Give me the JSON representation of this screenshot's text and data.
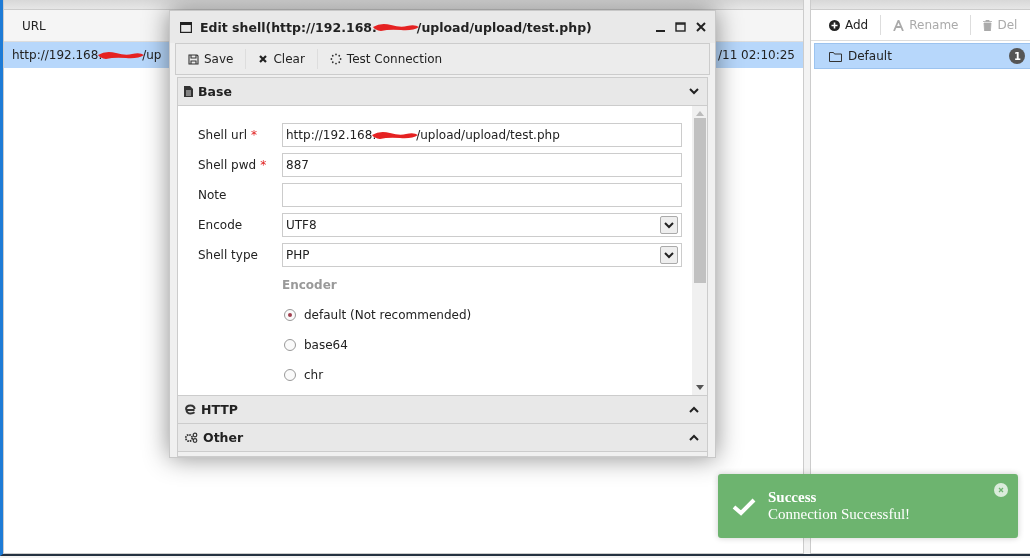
{
  "grid": {
    "columns": [
      {
        "label": "URL"
      }
    ],
    "rows": [
      {
        "url_parts": [
          "http://192.168.",
          "/up"
        ],
        "date": "/11 02:10:25",
        "selected": true
      }
    ]
  },
  "category": {
    "toolbar": [
      {
        "label": "Add",
        "disabled": false
      },
      {
        "label": "Rename",
        "disabled": true
      },
      {
        "label": "Del",
        "disabled": true
      }
    ],
    "items": [
      {
        "label": "Default",
        "count": "1",
        "selected": true
      }
    ]
  },
  "dialog": {
    "title_parts": [
      "Edit shell(http://192.168.",
      "/upload/upload/test.php)"
    ],
    "toolbar": [
      {
        "label": "Save"
      },
      {
        "label": "Clear"
      },
      {
        "label": "Test Connection"
      }
    ],
    "sections": [
      {
        "title": "Base",
        "expanded": true
      },
      {
        "title": "HTTP",
        "expanded": false
      },
      {
        "title": "Other",
        "expanded": false
      }
    ],
    "fields": [
      {
        "label": "Shell url",
        "required_mark": "*",
        "kind": "text",
        "value_parts": [
          "http://192.168.",
          "/upload/upload/test.php"
        ]
      },
      {
        "label": "Shell pwd",
        "required_mark": "*",
        "kind": "text",
        "value_parts": [
          "887"
        ]
      },
      {
        "label": "Note",
        "kind": "text"
      },
      {
        "label": "Encode",
        "kind": "select",
        "value_parts": [
          "UTF8"
        ]
      },
      {
        "label": "Shell type",
        "kind": "select",
        "value_parts": [
          "PHP"
        ]
      }
    ],
    "encoder": {
      "heading": "Encoder",
      "options": [
        {
          "label": "default (Not recommended)",
          "selected": true
        },
        {
          "label": "base64",
          "selected": false
        },
        {
          "label": "chr",
          "selected": false
        }
      ]
    }
  },
  "toast": {
    "title": "Success",
    "message": "Connection Successful!"
  }
}
